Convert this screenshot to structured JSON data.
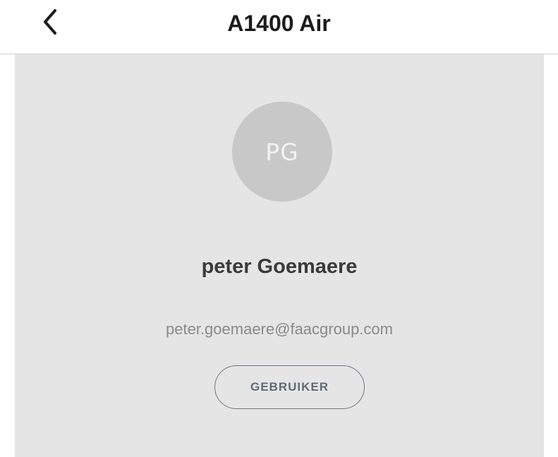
{
  "header": {
    "back_icon": "chevron-left-icon",
    "title": "A1400 Air"
  },
  "profile": {
    "initials": "PG",
    "name": "peter Goemaere",
    "email": "peter.goemaere@faacgroup.com",
    "role": "GEBRUIKER"
  },
  "colors": {
    "panel_background": "#e6e5e6",
    "avatar_background": "#c8c8c8",
    "role_text": "#5f6b78"
  }
}
